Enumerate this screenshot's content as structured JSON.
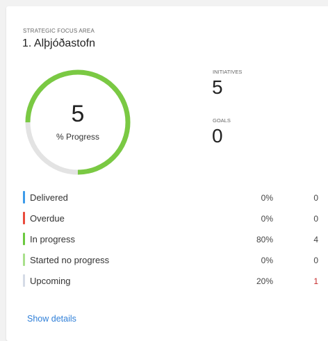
{
  "card": {
    "eyebrow": "STRATEGIC FOCUS AREA",
    "title": "1. Alþjóðastofn"
  },
  "progress": {
    "value": "5",
    "label": "% Progress",
    "fraction": 0.75,
    "color_done": "#7ac943",
    "color_remaining": "#e3e3e3"
  },
  "stats": {
    "initiatives": {
      "label": "INITIATIVES",
      "value": "5"
    },
    "goals": {
      "label": "GOALS",
      "value": "0"
    }
  },
  "legend": [
    {
      "name": "Delivered",
      "pct": "0%",
      "count": "0",
      "color": "#3d9be9"
    },
    {
      "name": "Overdue",
      "pct": "0%",
      "count": "0",
      "color": "#e94b3c"
    },
    {
      "name": "In progress",
      "pct": "80%",
      "count": "4",
      "color": "#6cc93f"
    },
    {
      "name": "Started no progress",
      "pct": "0%",
      "count": "0",
      "color": "#a9e08c"
    },
    {
      "name": "Upcoming",
      "pct": "20%",
      "count": "1",
      "color": "#d5dbe6"
    }
  ],
  "actions": {
    "show_details": "Show details"
  }
}
